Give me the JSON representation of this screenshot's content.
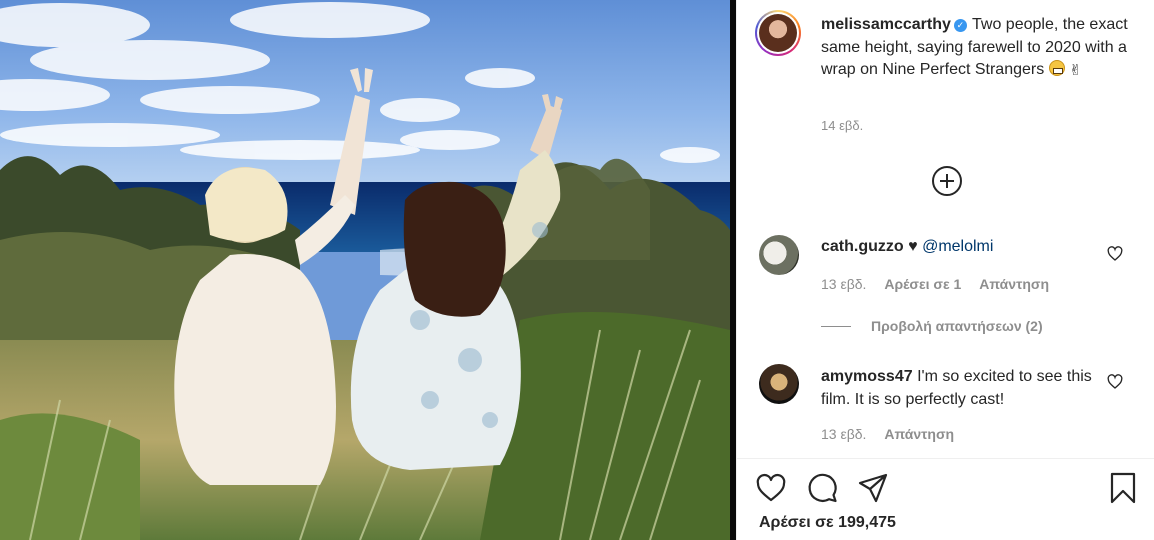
{
  "post": {
    "author": "melissamccarthy",
    "caption_text": "Two people, the exact same height, saying farewell to 2020 with a wrap on Nine Perfect Strangers",
    "emojis": [
      "grimacing-face",
      "victory-hand"
    ],
    "victory_glyph": "✌",
    "time": "14 εβδ."
  },
  "comments": [
    {
      "username": "cath.guzzo",
      "heart_glyph": "♥",
      "mention": "@melolmi",
      "text": "",
      "time": "13 εβδ.",
      "likes_label": "Αρέσει σε 1",
      "reply_label": "Απάντηση",
      "view_replies_label": "Προβολή απαντήσεων (2)"
    },
    {
      "username": "amymoss47",
      "text": "I'm so excited to see this film. It is so perfectly cast!",
      "time": "13 εβδ.",
      "reply_label": "Απάντηση"
    }
  ],
  "footer": {
    "likes_label": "Αρέσει σε 199,475"
  },
  "colors": {
    "verified": "#3897f0",
    "text": "#262626",
    "muted": "#8e8e8e",
    "mention": "#00376b"
  },
  "icons": [
    "plus-circle-icon",
    "heart-icon",
    "comment-icon",
    "share-icon",
    "bookmark-icon",
    "verified-badge-icon"
  ]
}
